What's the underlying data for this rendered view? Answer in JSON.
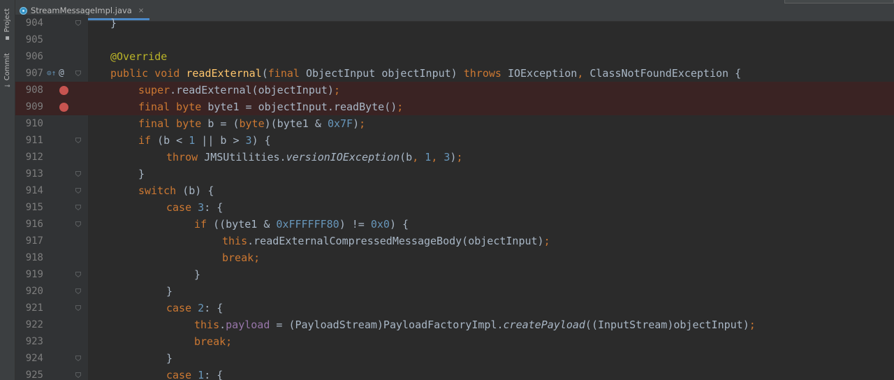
{
  "toolwindows": [
    {
      "label": "Project",
      "icon": "folder-icon"
    },
    {
      "label": "Commit",
      "icon": "commit-icon"
    }
  ],
  "editor": {
    "tab": {
      "file_name": "StreamMessageImpl.java",
      "close_glyph": "×"
    },
    "lines": [
      {
        "num": "904",
        "indent": 0,
        "fold": true,
        "tokens": [
          [
            "p",
            "}"
          ]
        ]
      },
      {
        "num": "905",
        "indent": 0,
        "tokens": []
      },
      {
        "num": "906",
        "indent": 0,
        "tokens": [
          [
            "anno",
            "@Override"
          ]
        ]
      },
      {
        "num": "907",
        "indent": 0,
        "fold": true,
        "implements_marker": "⊙↑",
        "annotation_marker": "@",
        "tokens": [
          [
            "kw",
            "public void "
          ],
          [
            "fn",
            "readExternal"
          ],
          [
            "p",
            "("
          ],
          [
            "kw",
            "final "
          ],
          [
            "p",
            "ObjectInput objectInput) "
          ],
          [
            "kw",
            "throws "
          ],
          [
            "p",
            "IOException"
          ],
          [
            "kw",
            ", "
          ],
          [
            "p",
            "ClassNotFoundException {"
          ]
        ]
      },
      {
        "num": "908",
        "indent": 1,
        "breakpoint": true,
        "tokens": [
          [
            "kw",
            "super"
          ],
          [
            "p",
            ".readExternal(objectInput)"
          ],
          [
            "kw",
            ";"
          ]
        ]
      },
      {
        "num": "909",
        "indent": 1,
        "breakpoint": true,
        "tokens": [
          [
            "kw",
            "final byte "
          ],
          [
            "p",
            "byte1 = objectInput.readByte()"
          ],
          [
            "kw",
            ";"
          ]
        ]
      },
      {
        "num": "910",
        "indent": 1,
        "tokens": [
          [
            "kw",
            "final byte "
          ],
          [
            "p",
            "b = ("
          ],
          [
            "kw",
            "byte"
          ],
          [
            "p",
            ")(byte1 & "
          ],
          [
            "num",
            "0x7F"
          ],
          [
            "p",
            ")"
          ],
          [
            "kw",
            ";"
          ]
        ]
      },
      {
        "num": "911",
        "indent": 1,
        "fold": true,
        "tokens": [
          [
            "kw",
            "if "
          ],
          [
            "p",
            "(b < "
          ],
          [
            "num",
            "1"
          ],
          [
            "p",
            " || b > "
          ],
          [
            "num",
            "3"
          ],
          [
            "p",
            ") {"
          ]
        ]
      },
      {
        "num": "912",
        "indent": 2,
        "tokens": [
          [
            "kw",
            "throw "
          ],
          [
            "p",
            "JMSUtilities."
          ],
          [
            "it",
            "versionIOException"
          ],
          [
            "p",
            "(b"
          ],
          [
            "kw",
            ", "
          ],
          [
            "num",
            "1"
          ],
          [
            "kw",
            ", "
          ],
          [
            "num",
            "3"
          ],
          [
            "p",
            ")"
          ],
          [
            "kw",
            ";"
          ]
        ]
      },
      {
        "num": "913",
        "indent": 1,
        "fold": true,
        "tokens": [
          [
            "p",
            "}"
          ]
        ]
      },
      {
        "num": "914",
        "indent": 1,
        "fold": true,
        "tokens": [
          [
            "kw",
            "switch "
          ],
          [
            "p",
            "(b) {"
          ]
        ]
      },
      {
        "num": "915",
        "indent": 2,
        "fold": true,
        "tokens": [
          [
            "kw",
            "case "
          ],
          [
            "num",
            "3"
          ],
          [
            "p",
            ": {"
          ]
        ]
      },
      {
        "num": "916",
        "indent": 3,
        "fold": true,
        "tokens": [
          [
            "kw",
            "if "
          ],
          [
            "p",
            "((byte1 & "
          ],
          [
            "num",
            "0xFFFFFF80"
          ],
          [
            "p",
            ") != "
          ],
          [
            "num",
            "0x0"
          ],
          [
            "p",
            ") {"
          ]
        ]
      },
      {
        "num": "917",
        "indent": 4,
        "tokens": [
          [
            "kw",
            "this"
          ],
          [
            "p",
            ".readExternalCompressedMessageBody(objectInput)"
          ],
          [
            "kw",
            ";"
          ]
        ]
      },
      {
        "num": "918",
        "indent": 4,
        "tokens": [
          [
            "kw",
            "break;"
          ]
        ]
      },
      {
        "num": "919",
        "indent": 3,
        "fold": true,
        "tokens": [
          [
            "p",
            "}"
          ]
        ]
      },
      {
        "num": "920",
        "indent": 2,
        "fold": true,
        "tokens": [
          [
            "p",
            "}"
          ]
        ]
      },
      {
        "num": "921",
        "indent": 2,
        "fold": true,
        "tokens": [
          [
            "kw",
            "case "
          ],
          [
            "num",
            "2"
          ],
          [
            "p",
            ": {"
          ]
        ]
      },
      {
        "num": "922",
        "indent": 3,
        "tokens": [
          [
            "kw",
            "this"
          ],
          [
            "p",
            "."
          ],
          [
            "field",
            "payload"
          ],
          [
            "p",
            " = (PayloadStream)PayloadFactoryImpl."
          ],
          [
            "it",
            "createPayload"
          ],
          [
            "p",
            "((InputStream)objectInput)"
          ],
          [
            "kw",
            ";"
          ]
        ]
      },
      {
        "num": "923",
        "indent": 3,
        "tokens": [
          [
            "kw",
            "break;"
          ]
        ]
      },
      {
        "num": "924",
        "indent": 2,
        "fold": true,
        "tokens": [
          [
            "p",
            "}"
          ]
        ]
      },
      {
        "num": "925",
        "indent": 2,
        "fold": true,
        "tokens": [
          [
            "kw",
            "case "
          ],
          [
            "num",
            "1"
          ],
          [
            "p",
            ": {"
          ]
        ]
      }
    ]
  }
}
